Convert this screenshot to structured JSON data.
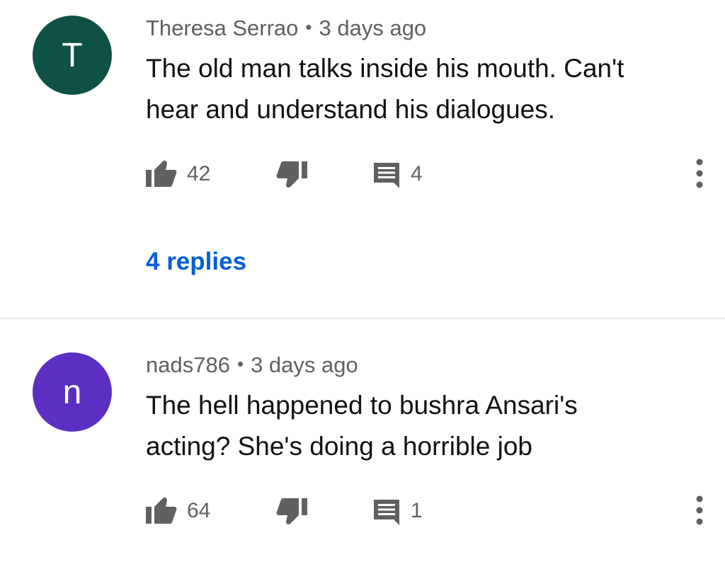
{
  "comments": [
    {
      "avatar_letter": "T",
      "avatar_color": "#0e5245",
      "author": "Theresa Serrao",
      "separator": "•",
      "time": "3 days ago",
      "text_line1": "The old man talks inside his mouth. Can't",
      "text_line2": "hear and understand his dialogues.",
      "likes": "42",
      "replies_count": "4",
      "replies_link": "4 replies"
    },
    {
      "avatar_letter": "n",
      "avatar_color": "#5c2fc2",
      "author": "nads786",
      "separator": "•",
      "time": "3 days ago",
      "text_line1": "The hell happened to bushra Ansari's",
      "text_line2": "acting?  She's doing a horrible job",
      "likes": "64",
      "replies_count": "1"
    }
  ],
  "icons": {
    "like": "thumb-up-icon",
    "dislike": "thumb-down-icon",
    "reply": "comment-icon",
    "more": "more-vertical-icon"
  },
  "colors": {
    "link": "#065fd4",
    "meta": "#606060",
    "icon": "#606060"
  }
}
